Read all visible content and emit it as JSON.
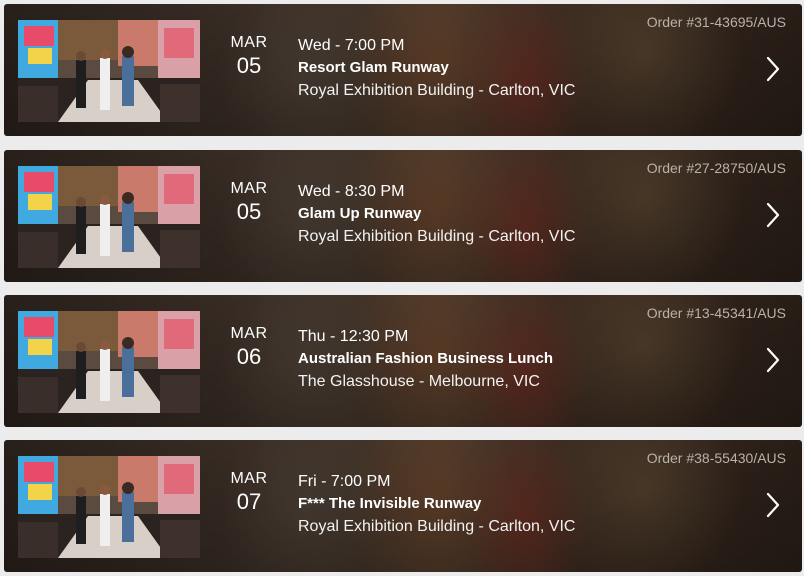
{
  "orders": [
    {
      "order_number": "Order #31-43695/AUS",
      "month": "MAR",
      "day": "05",
      "time": "Wed - 7:00 PM",
      "title": "Resort Glam Runway",
      "venue": "Royal Exhibition Building - Carlton, VIC",
      "thumbnail": "runway-photo",
      "chevron": "chevron-right-icon"
    },
    {
      "order_number": "Order #27-28750/AUS",
      "month": "MAR",
      "day": "05",
      "time": "Wed - 8:30 PM",
      "title": "Glam Up Runway",
      "venue": "Royal Exhibition Building - Carlton, VIC",
      "thumbnail": "runway-photo",
      "chevron": "chevron-right-icon"
    },
    {
      "order_number": "Order #13-45341/AUS",
      "month": "MAR",
      "day": "06",
      "time": "Thu - 12:30 PM",
      "title": "Australian Fashion Business Lunch",
      "venue": "The Glasshouse - Melbourne, VIC",
      "thumbnail": "runway-photo",
      "chevron": "chevron-right-icon"
    },
    {
      "order_number": "Order #38-55430/AUS",
      "month": "MAR",
      "day": "07",
      "time": "Fri - 7:00 PM",
      "title": "F*** The Invisible Runway",
      "venue": "Royal Exhibition Building - Carlton, VIC",
      "thumbnail": "runway-photo",
      "chevron": "chevron-right-icon"
    }
  ],
  "colors": {
    "text": "#ffffff",
    "order_text": "#b9b1ab",
    "page_background": "#ececec",
    "card_background": "#3a2d24"
  }
}
